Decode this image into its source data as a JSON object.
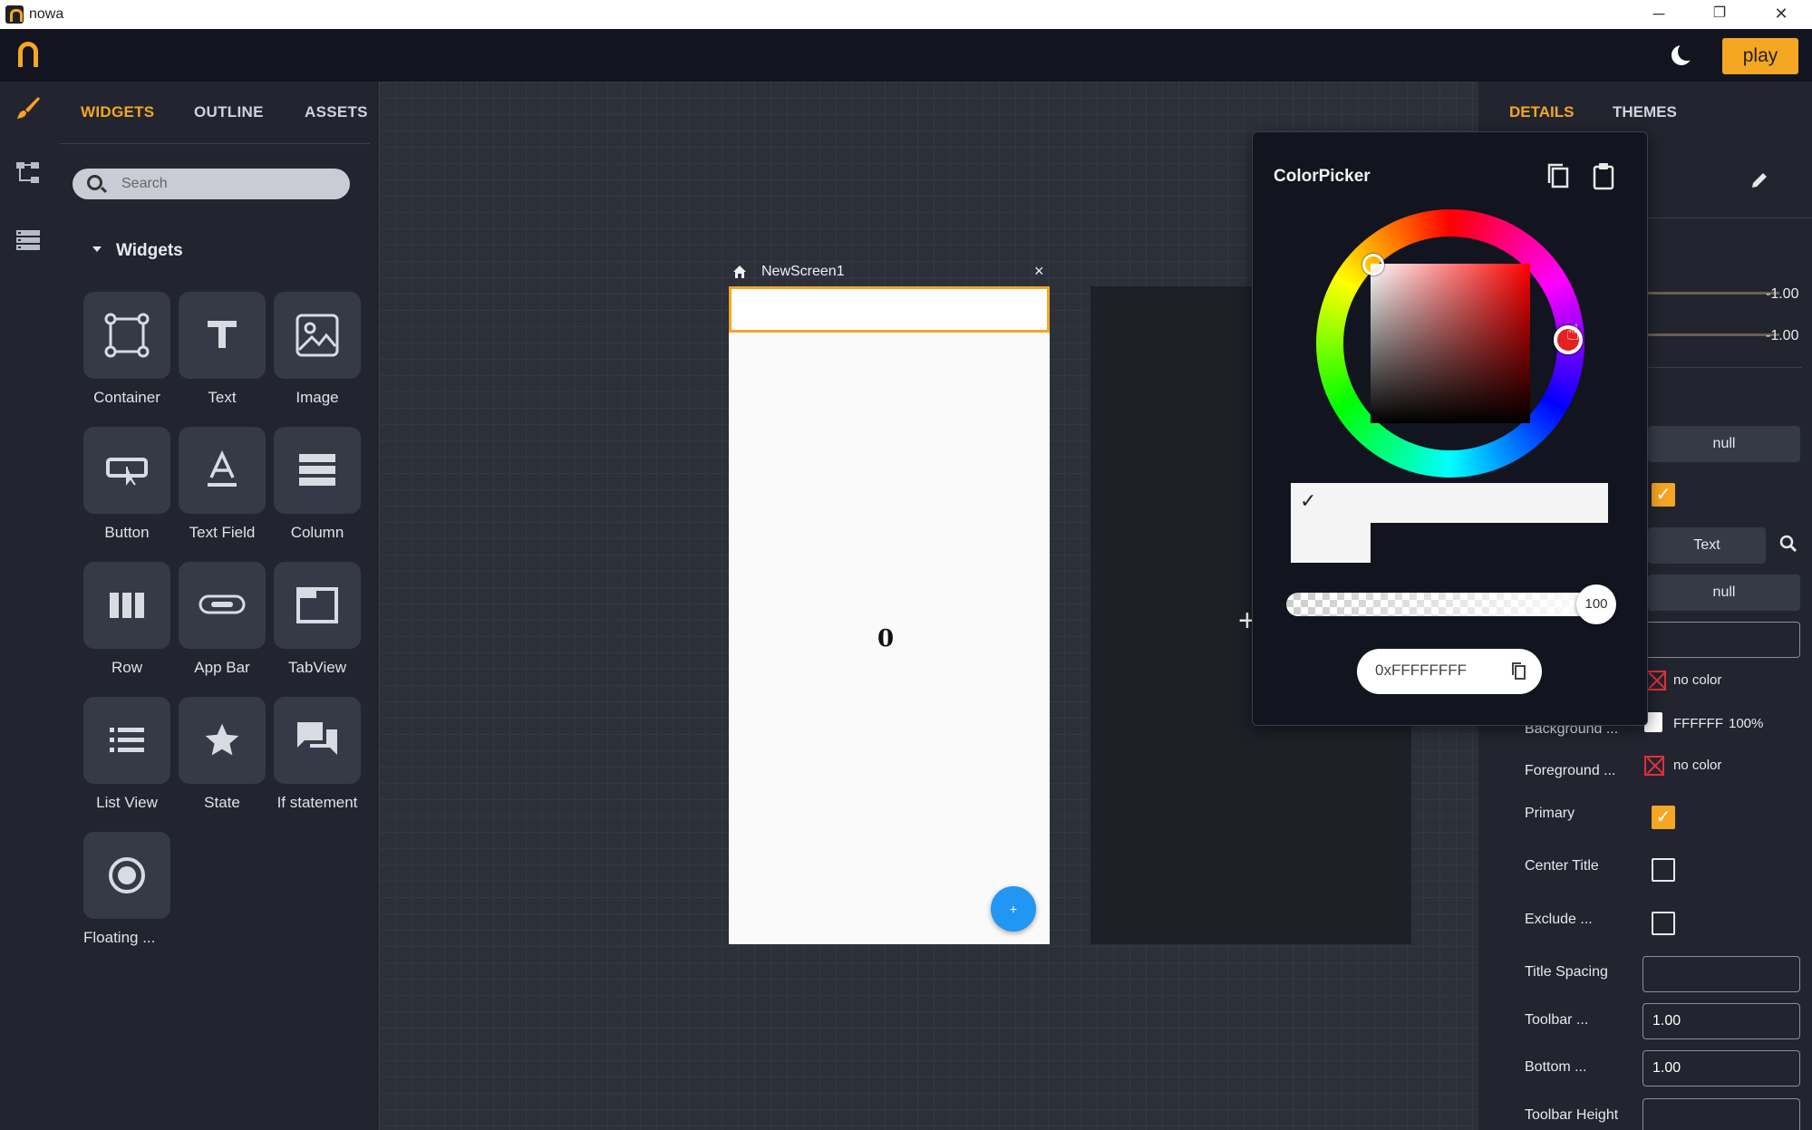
{
  "window": {
    "title": "nowa",
    "minimize": "─",
    "restore": "❐",
    "close": "✕"
  },
  "topbar": {
    "play_label": "play"
  },
  "left_panel": {
    "tabs": [
      "WIDGETS",
      "OUTLINE",
      "ASSETS"
    ],
    "active_tab": "WIDGETS",
    "search_placeholder": "Search",
    "section_title": "Widgets",
    "widgets": [
      {
        "label": "Container",
        "icon": "container-icon"
      },
      {
        "label": "Text",
        "icon": "text-icon"
      },
      {
        "label": "Image",
        "icon": "image-icon"
      },
      {
        "label": "Button",
        "icon": "button-icon"
      },
      {
        "label": "Text Field",
        "icon": "text-field-icon"
      },
      {
        "label": "Column",
        "icon": "column-icon"
      },
      {
        "label": "Row",
        "icon": "row-icon"
      },
      {
        "label": "App Bar",
        "icon": "app-bar-icon"
      },
      {
        "label": "TabView",
        "icon": "tabview-icon"
      },
      {
        "label": "List View",
        "icon": "list-view-icon"
      },
      {
        "label": "State",
        "icon": "star-icon"
      },
      {
        "label": "If statement",
        "icon": "chat-icon"
      },
      {
        "label": "Floating ...",
        "icon": "radio-icon"
      }
    ]
  },
  "canvas": {
    "screen_name": "NewScreen1",
    "close_glyph": "×",
    "counter_text": "0",
    "fab_label": "+",
    "crosshair": "+"
  },
  "right_panel": {
    "tabs": [
      "DETAILS",
      "THEMES"
    ],
    "active_tab": "DETAILS",
    "values": {
      "slider1": "-1.00",
      "slider2": "-1.00",
      "null1": "null",
      "text_button": "Text",
      "null2": "null",
      "no_color1": "no color",
      "background_label": "Background ...",
      "background_hex": "FFFFFF",
      "background_opacity": "100%",
      "foreground_label": "Foreground ...",
      "no_color2": "no color",
      "primary_label": "Primary",
      "center_title_label": "Center Title",
      "exclude_label": "Exclude ...",
      "title_spacing_label": "Title Spacing",
      "toolbar_label": "Toolbar ...",
      "toolbar_value": "1.00",
      "bottom_label": "Bottom ...",
      "bottom_value": "1.00",
      "toolbar_height_label": "Toolbar Height"
    },
    "primary_checked": true,
    "center_title_checked": false,
    "exclude_checked": false
  },
  "color_picker": {
    "title": "ColorPicker",
    "opacity_value": "100",
    "hex_value": "0xFFFFFFFF",
    "current_color": "#FFFFFF",
    "hue_color": "#FF0000"
  },
  "colors": {
    "accent": "#f5a623",
    "fab": "#2196f3",
    "no_color_red": "#e0303a"
  }
}
